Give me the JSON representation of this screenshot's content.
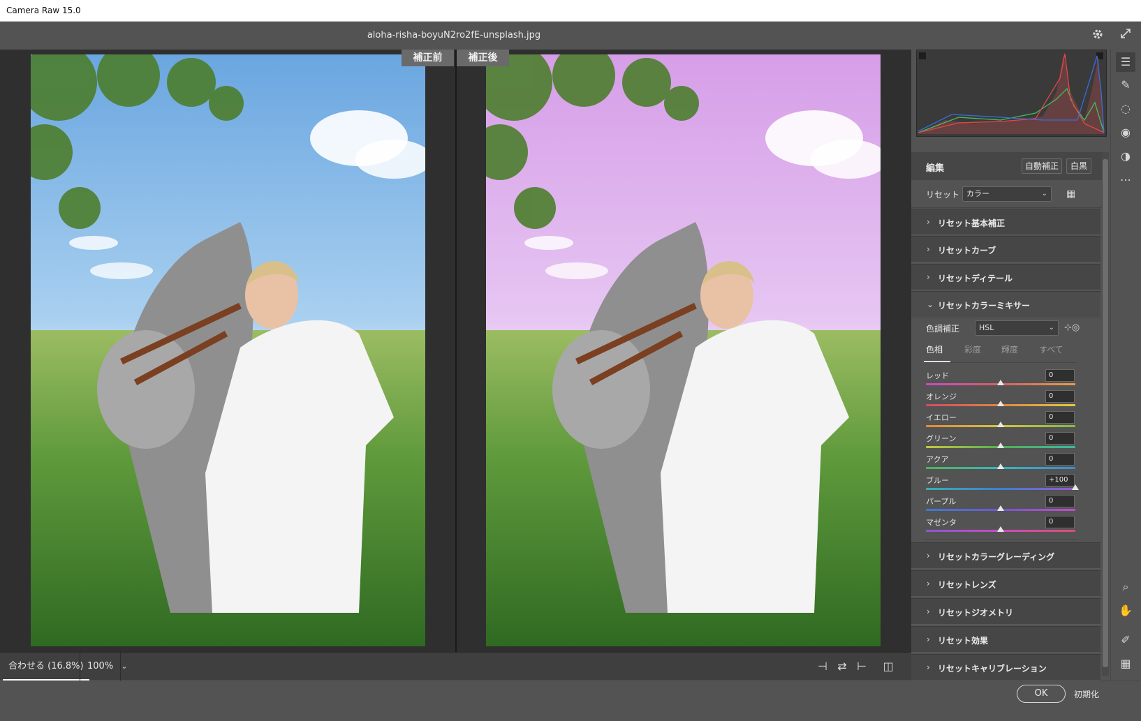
{
  "window": {
    "title": "Camera Raw 15.0"
  },
  "file": {
    "name": "aloha-risha-boyuN2ro2fE-unsplash.jpg"
  },
  "viewer": {
    "before_label": "補正前",
    "after_label": "補正後",
    "zoom_fit": "合わせる (16.8%)",
    "zoom_pct": "100%"
  },
  "edit": {
    "title": "編集",
    "auto_button": "自動補正",
    "bw_button": "白黒",
    "preset_label": "リセット",
    "preset_value": "カラー"
  },
  "sections_top": [
    {
      "label": "リセット基本補正"
    },
    {
      "label": "リセットカーブ"
    },
    {
      "label": "リセットディテール"
    }
  ],
  "mixer": {
    "title": "リセットカラーミキサー",
    "adjust_label": "色調補正",
    "adjust_value": "HSL",
    "tabs": [
      "色相",
      "彩度",
      "輝度",
      "すべて"
    ],
    "active_tab": "色相",
    "sliders": [
      {
        "label": "レッド",
        "value": "0",
        "level": 0,
        "gradient": "linear-gradient(90deg,#c94ac4,#d86060,#e3a04a)"
      },
      {
        "label": "オレンジ",
        "value": "0",
        "level": 0,
        "gradient": "linear-gradient(90deg,#d64a63,#e0873e,#e7c843)"
      },
      {
        "label": "イエロー",
        "value": "0",
        "level": 0,
        "gradient": "linear-gradient(90deg,#e08a3c,#d6c440,#7fbb45)"
      },
      {
        "label": "グリーン",
        "value": "0",
        "level": 0,
        "gradient": "linear-gradient(90deg,#c9c63d,#54b154,#3ab8a6)"
      },
      {
        "label": "アクア",
        "value": "0",
        "level": 0,
        "gradient": "linear-gradient(90deg,#4cb65c,#3bb6b8,#3c8bd0)"
      },
      {
        "label": "ブルー",
        "value": "+100",
        "level": 1,
        "gradient": "linear-gradient(90deg,#3ab0b4,#3d7fd0,#9a58d1)"
      },
      {
        "label": "パープル",
        "value": "0",
        "level": 0,
        "gradient": "linear-gradient(90deg,#3b7bd0,#7357d2,#c74ac8)"
      },
      {
        "label": "マゼンタ",
        "value": "0",
        "level": 0,
        "gradient": "linear-gradient(90deg,#8a58d4,#cc49c2,#dd4f72)"
      }
    ]
  },
  "sections_bottom": [
    {
      "label": "リセットカラーグレーディング"
    },
    {
      "label": "リセットレンズ"
    },
    {
      "label": "リセットジオメトリ"
    },
    {
      "label": "リセット効果"
    },
    {
      "label": "リセットキャリブレーション"
    }
  ],
  "footer": {
    "ok": "OK",
    "reset": "初期化"
  },
  "colors": {
    "sky_before": "#7fb2e3",
    "sky_after": "#d9a4ea",
    "grass": "#5b9a3b"
  }
}
